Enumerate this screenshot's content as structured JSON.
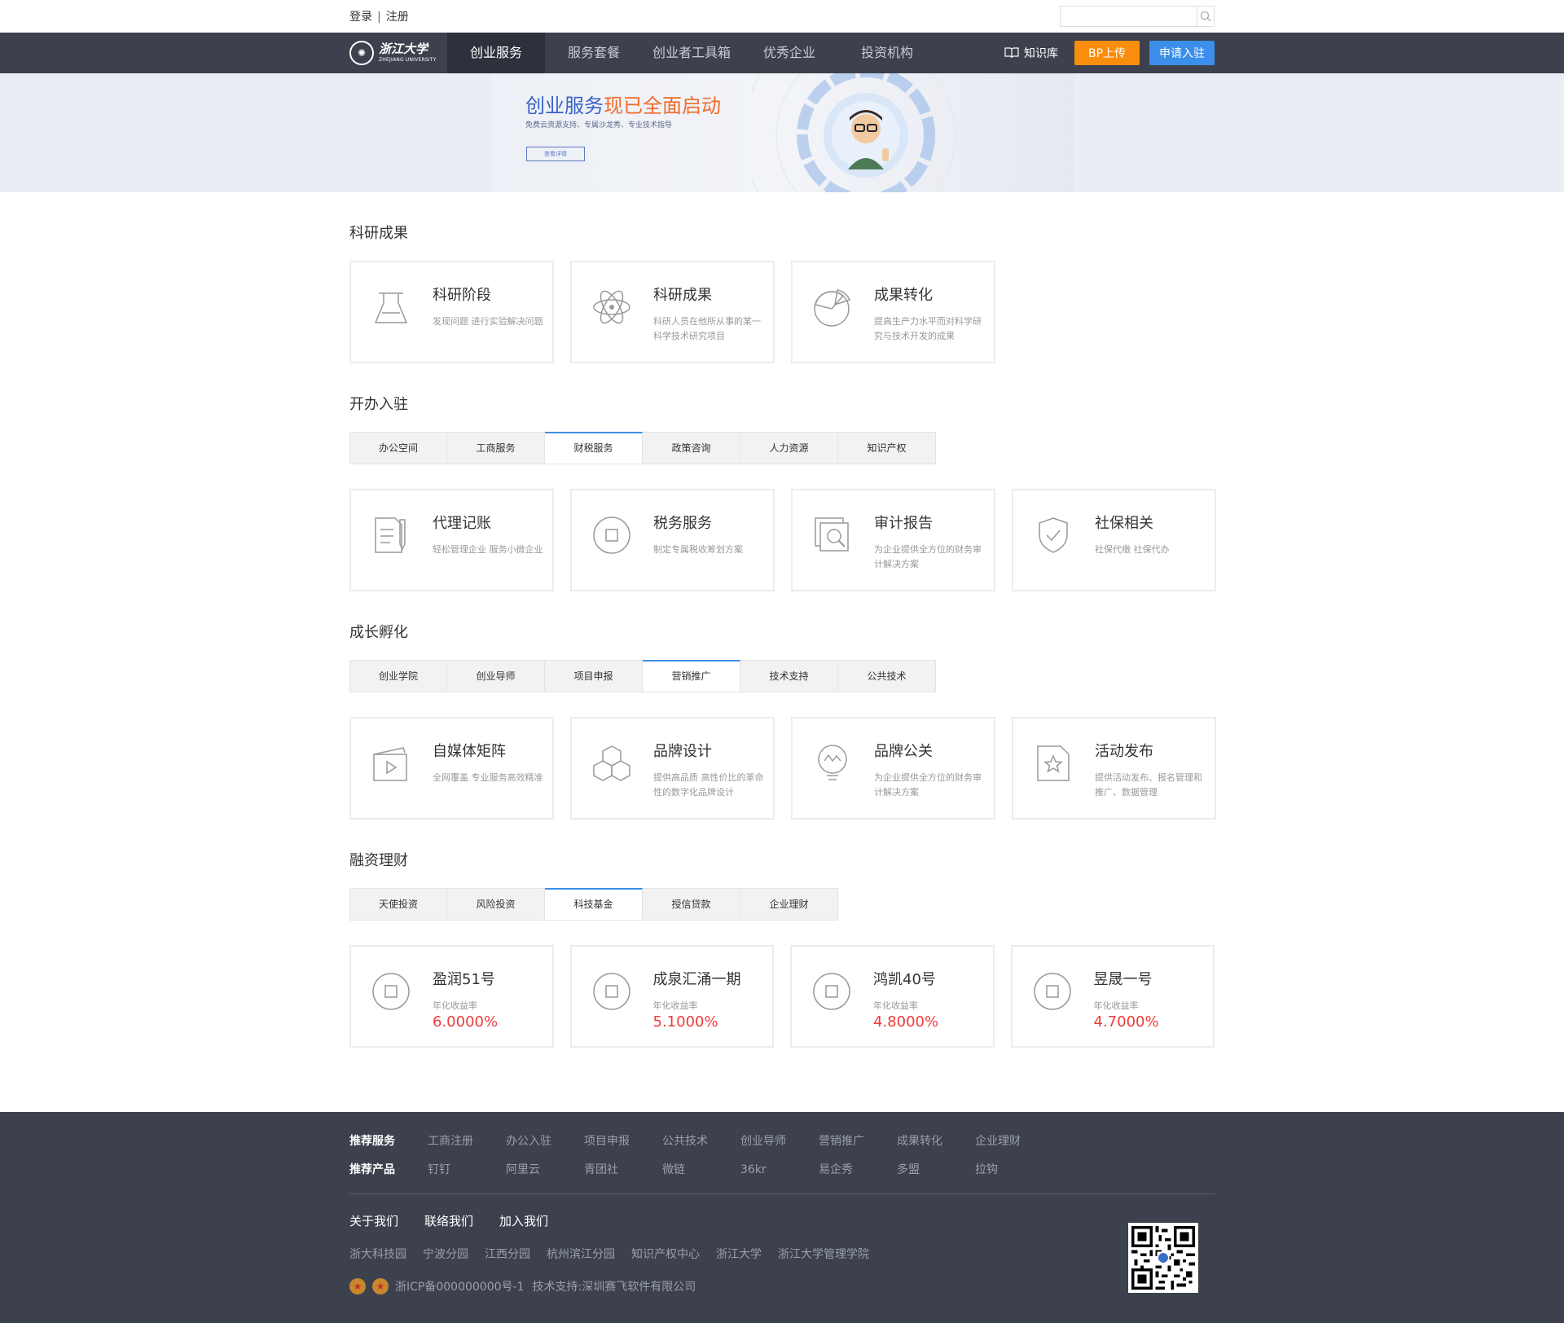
{
  "topbar": {
    "login": "登录",
    "separator": "|",
    "register": "注册",
    "search_placeholder": ""
  },
  "nav": {
    "logo_cn": "浙江大学",
    "logo_en": "ZHEJIANG UNIVERSITY",
    "items": [
      {
        "label": "创业服务",
        "active": true
      },
      {
        "label": "服务套餐",
        "active": false
      },
      {
        "label": "创业者工具箱",
        "active": false
      },
      {
        "label": "优秀企业",
        "active": false
      },
      {
        "label": "投资机构",
        "active": false
      }
    ],
    "knowledge": "知识库",
    "bp_upload": "BP上传",
    "apply": "申请入驻"
  },
  "banner": {
    "title_a": "创业服务",
    "title_b": "现已全面启动",
    "subtitle": "免费云资源支持、专属沙龙秀、专业技术指导",
    "button": "查看详情"
  },
  "research": {
    "title": "科研成果",
    "cards": [
      {
        "icon": "flask-icon",
        "title": "科研阶段",
        "desc": "发现问题 进行实验解决问题"
      },
      {
        "icon": "atom-icon",
        "title": "科研成果",
        "desc": "科研人员在他所从事的某一科学技术研究项目"
      },
      {
        "icon": "pie-chart-icon",
        "title": "成果转化",
        "desc": "提高生产力水平而对科学研究与技术开发的成果"
      }
    ]
  },
  "setup": {
    "title": "开办入驻",
    "tabs": [
      "办公空间",
      "工商服务",
      "财税服务",
      "政策咨询",
      "人力资源",
      "知识产权"
    ],
    "active_tab": 2,
    "cards": [
      {
        "icon": "document-pen-icon",
        "title": "代理记账",
        "desc": "轻松管理企业 服务小微企业"
      },
      {
        "icon": "square-circle-icon",
        "title": "税务服务",
        "desc": "制定专属税收筹划方案"
      },
      {
        "icon": "magnifier-doc-icon",
        "title": "审计报告",
        "desc": "为企业提供全方位的财务审计解决方案"
      },
      {
        "icon": "shield-check-icon",
        "title": "社保相关",
        "desc": "社保代缴 社保代办"
      }
    ]
  },
  "growth": {
    "title": "成长孵化",
    "tabs": [
      "创业学院",
      "创业导师",
      "项目申报",
      "营销推广",
      "技术支持",
      "公共技术"
    ],
    "active_tab": 3,
    "cards": [
      {
        "icon": "video-board-icon",
        "title": "自媒体矩阵",
        "desc": "全网覆盖 专业服务高效精准"
      },
      {
        "icon": "cubes-icon",
        "title": "品牌设计",
        "desc": "提供高品质 高性价比的革命性的数字化品牌设计"
      },
      {
        "icon": "bulb-icon",
        "title": "品牌公关",
        "desc": "为企业提供全方位的财务审计解决方案"
      },
      {
        "icon": "star-doc-icon",
        "title": "活动发布",
        "desc": "提供活动发布、报名管理和推广、数据管理"
      }
    ]
  },
  "finance": {
    "title": "融资理财",
    "tabs": [
      "天使投资",
      "风险投资",
      "科技基金",
      "授信贷款",
      "企业理财"
    ],
    "active_tab": 2,
    "rate_label": "年化收益率",
    "cards": [
      {
        "icon": "square-circle-icon",
        "title": "盈润51号",
        "rate": "6.0000%"
      },
      {
        "icon": "square-circle-icon",
        "title": "成泉汇涌一期",
        "rate": "5.1000%"
      },
      {
        "icon": "square-circle-icon",
        "title": "鸿凯40号",
        "rate": "4.8000%"
      },
      {
        "icon": "square-circle-icon",
        "title": "昱晟一号",
        "rate": "4.7000%"
      }
    ]
  },
  "footer": {
    "rec_services_label": "推荐服务",
    "rec_services": [
      "工商注册",
      "办公入驻",
      "项目申报",
      "公共技术",
      "创业导师",
      "营销推广",
      "成果转化",
      "企业理财"
    ],
    "rec_products_label": "推荐产品",
    "rec_products": [
      "钉钉",
      "阿里云",
      "青团社",
      "微链",
      "36kr",
      "易企秀",
      "多盟",
      "拉钩"
    ],
    "about": [
      "关于我们",
      "联络我们",
      "加入我们"
    ],
    "partners": [
      "浙大科技园",
      "宁波分园",
      "江西分园",
      "杭州滨江分园",
      "知识产权中心",
      "浙江大学",
      "浙江大学管理学院"
    ],
    "icp": "浙ICP备000000000号-1",
    "tech_support": "技术支持:深圳赛飞软件有限公司"
  },
  "colors": {
    "nav_bg": "#3c414d",
    "accent_blue": "#3b8eea",
    "accent_orange": "#f98d0e",
    "rate_red": "#f03b3b"
  }
}
